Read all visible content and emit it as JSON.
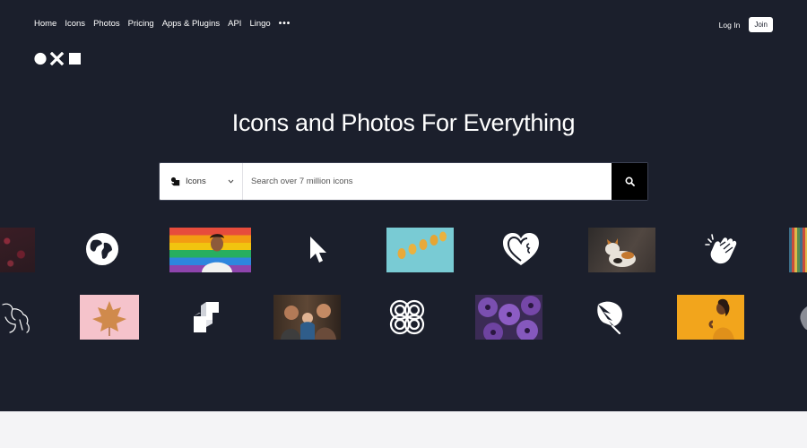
{
  "nav": {
    "home": "Home",
    "icons": "Icons",
    "photos": "Photos",
    "pricing": "Pricing",
    "apps_plugins": "Apps & Plugins",
    "api": "API",
    "lingo": "Lingo",
    "more": "•••"
  },
  "auth": {
    "login": "Log In",
    "join": "Join"
  },
  "hero": {
    "title": "Icons and Photos For Everything"
  },
  "search": {
    "filter_label": "Icons",
    "placeholder": "Search over 7 million icons"
  },
  "gallery": {
    "row1": [
      "photo-berries",
      "globe-icon",
      "photo-man-rainbow-flag",
      "cursor-icon",
      "photo-pears",
      "heart-face-icon",
      "photo-cat",
      "clapping-hands-icon",
      "photo-colored-pencils"
    ],
    "row2": [
      "dog-outline-icon",
      "photo-autumn-leaf",
      "blocks-icon",
      "photo-family",
      "knot-pattern-icon",
      "photo-purple-flowers",
      "monstera-leaf-icon",
      "photo-woman-yellow"
    ]
  },
  "colors": {
    "hero_bg": "#1b1f2c",
    "page_bg": "#f4f4f6",
    "search_button": "#000000"
  }
}
